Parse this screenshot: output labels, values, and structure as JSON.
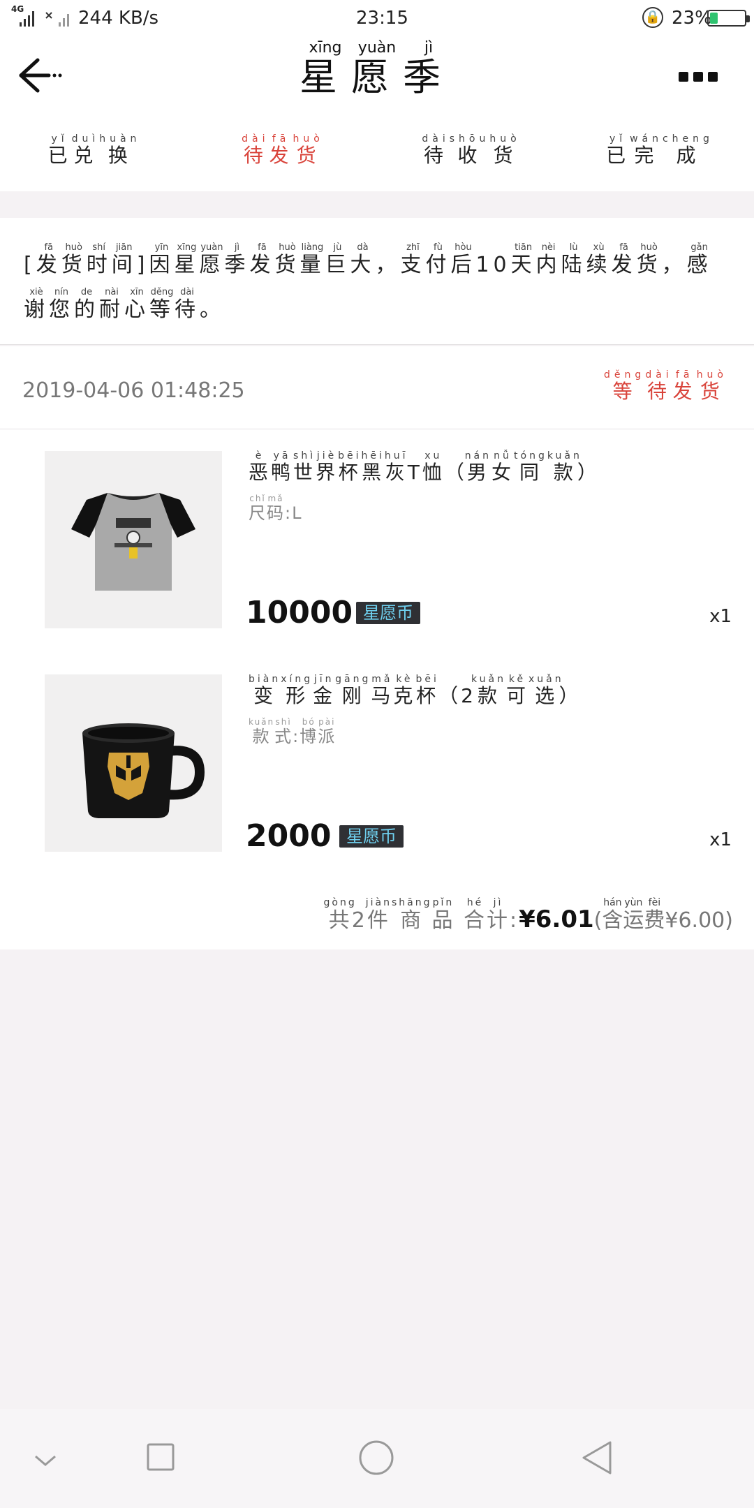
{
  "status_bar": {
    "network": "4G",
    "speed": "244 KB/s",
    "time": "23:15",
    "battery": "23%",
    "battery_level": 0.23,
    "battery_color": "#2ec36f"
  },
  "header": {
    "title_chars": [
      "星",
      "愿",
      "季"
    ],
    "title_pinyin": [
      "xīng",
      "yuàn",
      "jì"
    ]
  },
  "tabs": [
    {
      "chars": [
        "已",
        "兑",
        "换"
      ],
      "pinyin": [
        "yǐ",
        "duì",
        "huàn"
      ],
      "active": false
    },
    {
      "chars": [
        "待",
        "发",
        "货"
      ],
      "pinyin": [
        "dài",
        "fā",
        "huò"
      ],
      "active": true
    },
    {
      "chars": [
        "待",
        "收",
        "货"
      ],
      "pinyin": [
        "dài",
        "shōu",
        "huò"
      ],
      "active": false
    },
    {
      "chars": [
        "已",
        "完",
        "成"
      ],
      "pinyin": [
        "yǐ",
        "wán",
        "cheng"
      ],
      "active": false
    }
  ],
  "accent_color": "#d9433a",
  "notice": {
    "segments": [
      {
        "text": "["
      },
      {
        "text": "发",
        "py": "fā"
      },
      {
        "text": "货",
        "py": "huò"
      },
      {
        "text": "时",
        "py": "shí"
      },
      {
        "text": "间",
        "py": "jiān"
      },
      {
        "text": "]"
      },
      {
        "text": "因",
        "py": "yīn"
      },
      {
        "text": "星",
        "py": "xīng"
      },
      {
        "text": "愿",
        "py": "yuàn"
      },
      {
        "text": "季",
        "py": "jì"
      },
      {
        "text": "发",
        "py": "fā"
      },
      {
        "text": "货",
        "py": "huò"
      },
      {
        "text": "量",
        "py": "liàng"
      },
      {
        "text": "巨",
        "py": "jù"
      },
      {
        "text": "大",
        "py": "dà"
      },
      {
        "text": "，"
      },
      {
        "text": "支",
        "py": "zhī"
      },
      {
        "text": "付",
        "py": "fù"
      },
      {
        "text": "后",
        "py": "hòu"
      },
      {
        "text": "10"
      },
      {
        "text": "天",
        "py": "tiān"
      },
      {
        "text": "内",
        "py": "nèi"
      },
      {
        "text": "陆",
        "py": "lù"
      },
      {
        "text": "续",
        "py": "xù"
      },
      {
        "text": "发",
        "py": "fā"
      },
      {
        "text": "货",
        "py": "huò"
      },
      {
        "text": "，"
      },
      {
        "text": "感",
        "py": "gǎn"
      },
      {
        "text": "谢",
        "py": "xiè"
      },
      {
        "text": "您",
        "py": "nín"
      },
      {
        "text": "的",
        "py": "de"
      },
      {
        "text": "耐",
        "py": "nài"
      },
      {
        "text": "心",
        "py": "xīn"
      },
      {
        "text": "等",
        "py": "děng"
      },
      {
        "text": "待",
        "py": "dài"
      },
      {
        "text": "。"
      }
    ]
  },
  "order": {
    "time": "2019-04-06 01:48:25",
    "status_chars": [
      "等",
      "待",
      "发",
      "货"
    ],
    "status_pinyin": [
      "děng",
      "dài",
      "fā",
      "huò"
    ],
    "products": [
      {
        "name_segments": [
          {
            "text": "恶",
            "py": "è"
          },
          {
            "text": "鸭",
            "py": "yā"
          },
          {
            "text": "世",
            "py": "shì"
          },
          {
            "text": "界",
            "py": "jiè"
          },
          {
            "text": "杯",
            "py": "bēi"
          },
          {
            "text": "黑",
            "py": "hēi"
          },
          {
            "text": "灰",
            "py": "huī"
          },
          {
            "text": "T"
          },
          {
            "text": "恤",
            "py": "xu"
          },
          {
            "text": "（"
          },
          {
            "text": "男",
            "py": "nán"
          },
          {
            "text": "女",
            "py": "nǚ"
          },
          {
            "text": "同",
            "py": "tóng"
          },
          {
            "text": "款",
            "py": "kuǎn"
          },
          {
            "text": "）"
          }
        ],
        "spec_segments": [
          {
            "text": "尺",
            "py": "chǐ"
          },
          {
            "text": "码",
            "py": "mǎ"
          },
          {
            "text": ":L"
          }
        ],
        "price": "10000",
        "currency": "星愿币",
        "qty": "x1",
        "image": "grey-black-tshirt"
      },
      {
        "name_segments": [
          {
            "text": "变",
            "py": "biàn"
          },
          {
            "text": "形",
            "py": "xíng"
          },
          {
            "text": "金",
            "py": "jīn"
          },
          {
            "text": "刚",
            "py": "gāng"
          },
          {
            "text": "马",
            "py": "mǎ"
          },
          {
            "text": "克",
            "py": "kè"
          },
          {
            "text": "杯",
            "py": "bēi"
          },
          {
            "text": "（2"
          },
          {
            "text": "款",
            "py": "kuǎn"
          },
          {
            "text": "可",
            "py": "kě"
          },
          {
            "text": "选",
            "py": "xuǎn"
          },
          {
            "text": "）"
          }
        ],
        "spec_segments": [
          {
            "text": "款",
            "py": "kuǎn"
          },
          {
            "text": "式",
            "py": "shì"
          },
          {
            "text": ":"
          },
          {
            "text": "博",
            "py": "bó"
          },
          {
            "text": "派",
            "py": "pài"
          }
        ],
        "price": "2000",
        "currency": "星愿币",
        "qty": "x1",
        "image": "transformers-mug"
      }
    ],
    "summary": {
      "count_segments": [
        {
          "text": "共",
          "py": "gòng"
        },
        {
          "text": "2"
        },
        {
          "text": "件",
          "py": "jiàn"
        },
        {
          "text": "商",
          "py": "shāng"
        },
        {
          "text": "品",
          "py": "pǐn"
        },
        {
          "text": " "
        },
        {
          "text": "合",
          "py": "hé"
        },
        {
          "text": "计",
          "py": "jì"
        },
        {
          "text": ":"
        }
      ],
      "total": "¥6.01",
      "fee_segments": [
        {
          "text": "("
        },
        {
          "text": "含",
          "py": "hán"
        },
        {
          "text": "运",
          "py": "yùn"
        },
        {
          "text": "费",
          "py": "fèi"
        },
        {
          "text": "¥6.00)"
        }
      ]
    }
  },
  "navbar": {
    "icons": [
      "chevron-down-icon",
      "square-icon",
      "circle-icon",
      "triangle-back-icon"
    ]
  }
}
